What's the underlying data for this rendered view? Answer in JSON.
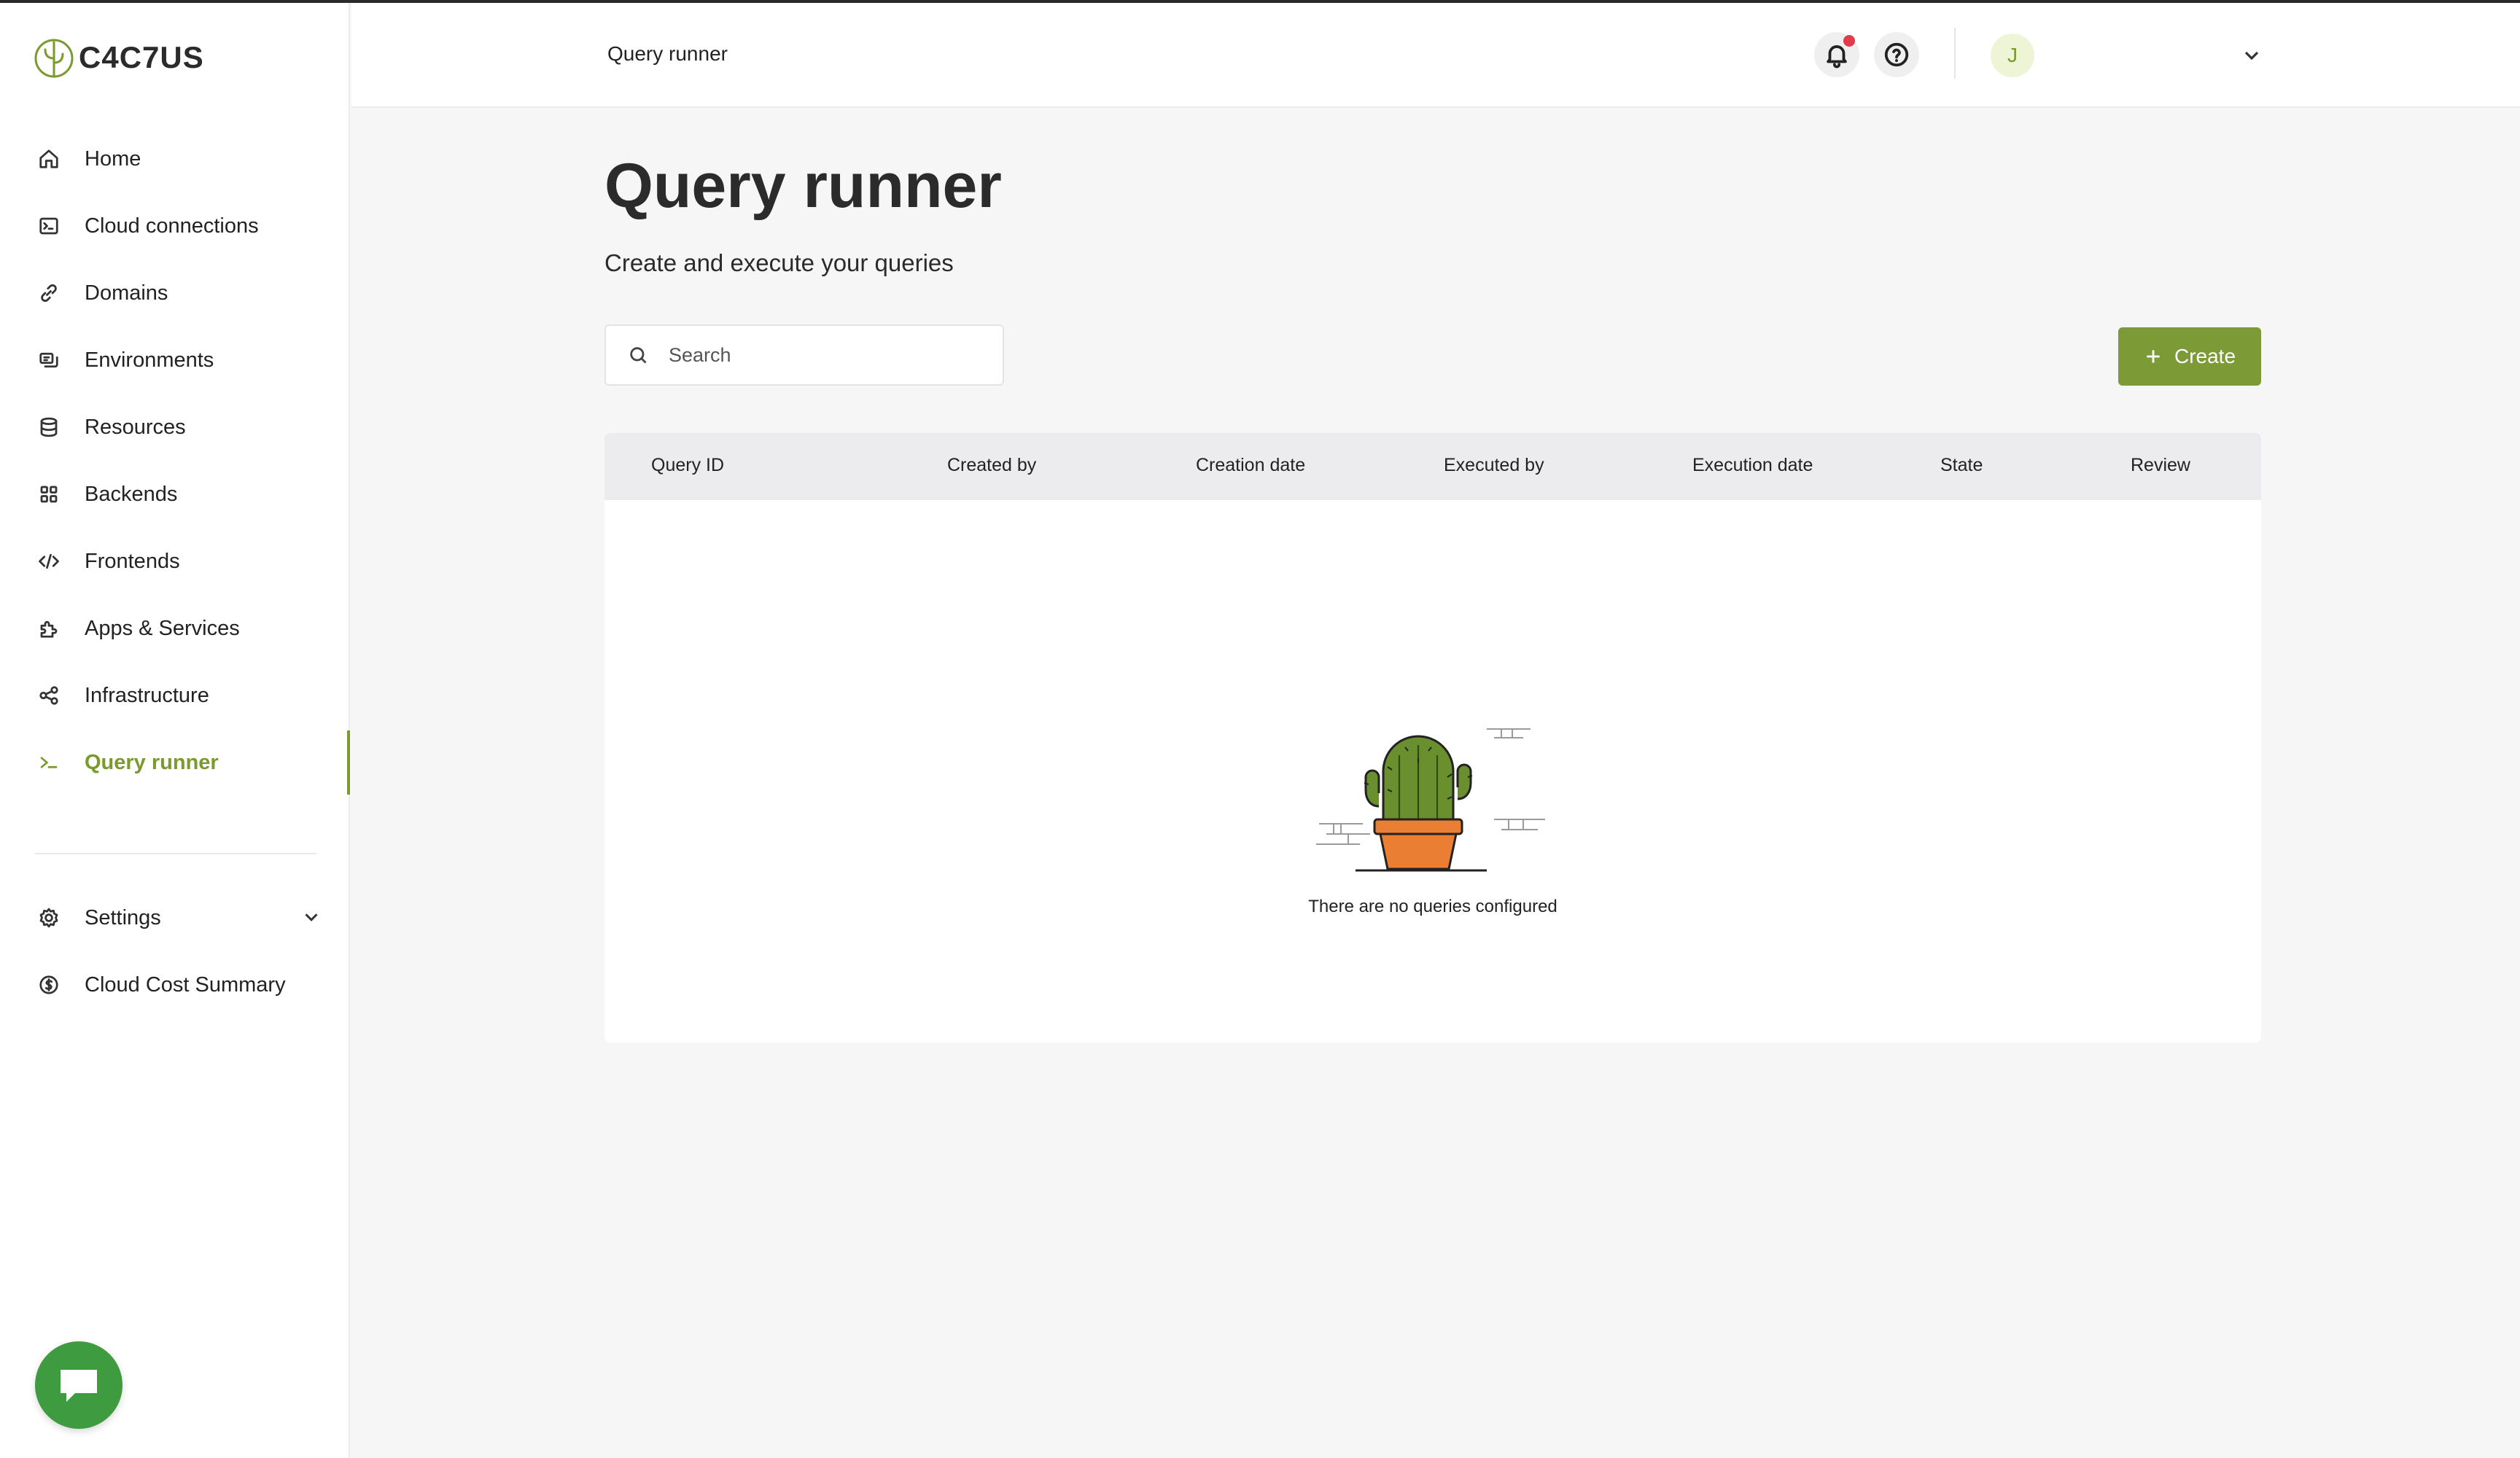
{
  "app": {
    "logo_text": "C4C7US"
  },
  "sidebar": {
    "items": [
      {
        "label": "Home",
        "icon": "home-icon"
      },
      {
        "label": "Cloud connections",
        "icon": "terminal-box-icon"
      },
      {
        "label": "Domains",
        "icon": "link-icon"
      },
      {
        "label": "Environments",
        "icon": "environments-icon"
      },
      {
        "label": "Resources",
        "icon": "database-icon"
      },
      {
        "label": "Backends",
        "icon": "grid-icon"
      },
      {
        "label": "Frontends",
        "icon": "code-icon"
      },
      {
        "label": "Apps & Services",
        "icon": "puzzle-icon"
      },
      {
        "label": "Infrastructure",
        "icon": "share-nodes-icon"
      },
      {
        "label": "Query runner",
        "icon": "prompt-icon",
        "active": true
      }
    ],
    "bottom_items": [
      {
        "label": "Settings",
        "icon": "gear-icon"
      },
      {
        "label": "Cloud Cost Summary",
        "icon": "dollar-circle-icon"
      }
    ]
  },
  "topbar": {
    "breadcrumb": "Query runner",
    "avatar_initial": "J"
  },
  "main": {
    "title": "Query runner",
    "subtitle": "Create and execute your queries",
    "search": {
      "placeholder": "Search",
      "value": ""
    },
    "create_label": "Create",
    "table": {
      "columns": [
        "Query ID",
        "Created by",
        "Creation date",
        "Executed by",
        "Execution date",
        "State",
        "Review"
      ],
      "rows": [],
      "empty_text": "There are no queries configured"
    }
  },
  "colors": {
    "accent": "#7c9a35",
    "chat_button": "#3f9b3f",
    "notification_dot": "#e23b4a"
  }
}
